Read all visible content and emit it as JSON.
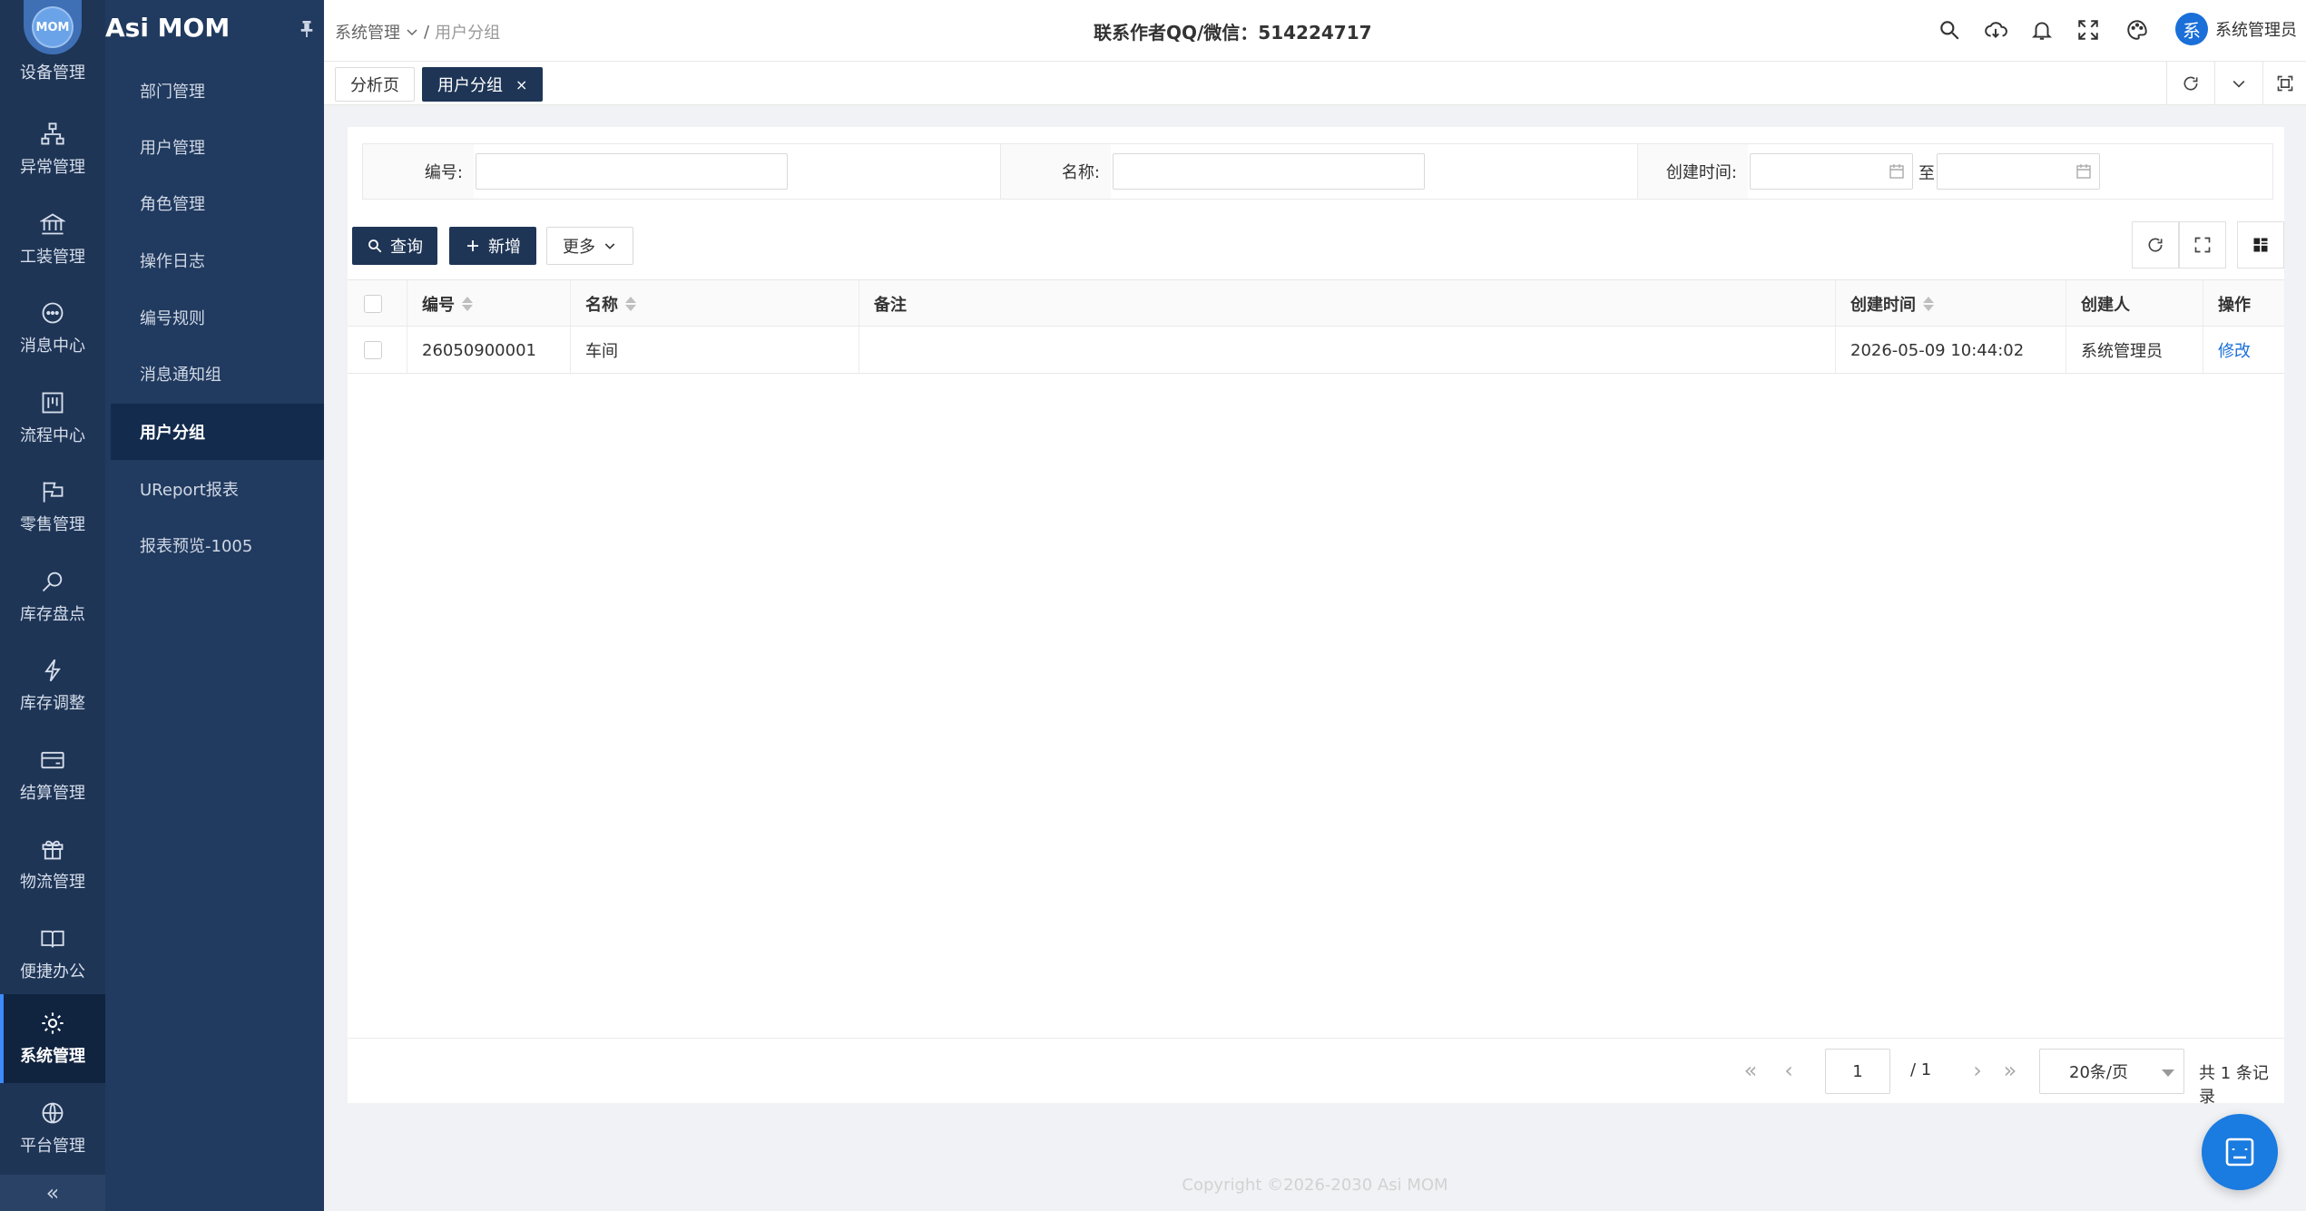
{
  "brand": {
    "logo_text": "MOM",
    "app_title": "Asi MOM"
  },
  "rail": {
    "first_label": "设备管理",
    "items": [
      {
        "label": "异常管理",
        "icon": "hierarchy-icon"
      },
      {
        "label": "工装管理",
        "icon": "bank-icon"
      },
      {
        "label": "消息中心",
        "icon": "chat-icon"
      },
      {
        "label": "流程中心",
        "icon": "board-icon"
      },
      {
        "label": "零售管理",
        "icon": "flag-icon"
      },
      {
        "label": "库存盘点",
        "icon": "magnify-icon"
      },
      {
        "label": "库存调整",
        "icon": "bolt-icon"
      },
      {
        "label": "结算管理",
        "icon": "wallet-icon"
      },
      {
        "label": "物流管理",
        "icon": "gift-icon"
      },
      {
        "label": "便捷办公",
        "icon": "book-icon"
      },
      {
        "label": "系统管理",
        "icon": "gear-icon",
        "active": true
      },
      {
        "label": "平台管理",
        "icon": "globe-icon"
      }
    ],
    "collapse": "«"
  },
  "submenu": {
    "items": [
      "部门管理",
      "用户管理",
      "角色管理",
      "操作日志",
      "编号规则",
      "消息通知组",
      "用户分组",
      "UReport报表",
      "报表预览-1005"
    ],
    "active_index": 6
  },
  "header": {
    "breadcrumb_parent": "系统管理",
    "breadcrumb_sep": "/",
    "breadcrumb_current": "用户分组",
    "contact": "联系作者QQ/微信：514224717",
    "user_avatar": "系",
    "user_name": "系统管理员"
  },
  "tabs": [
    {
      "label": "分析页",
      "active": false
    },
    {
      "label": "用户分组",
      "active": true,
      "close": "×"
    }
  ],
  "filters": {
    "code_label": "编号:",
    "code_value": "",
    "name_label": "名称:",
    "name_value": "",
    "time_label": "创建时间:",
    "time_sep": "至"
  },
  "toolbar": {
    "query": "查询",
    "add": "新增",
    "more": "更多"
  },
  "table": {
    "columns": [
      "编号",
      "名称",
      "备注",
      "创建时间",
      "创建人",
      "操作"
    ],
    "rows": [
      {
        "code": "26050900001",
        "name": "车间",
        "remark": "",
        "created": "2026-05-09 10:44:02",
        "creator": "系统管理员",
        "action": "修改"
      }
    ]
  },
  "pagination": {
    "page": "1",
    "total_pages": "/ 1",
    "page_size": "20条/页",
    "record_count": "共 1 条记录"
  },
  "footer": "Copyright ©2026-2030 Asi MOM",
  "colors": {
    "primary": "#1e3556",
    "rail": "#1e3556",
    "submenu": "#213a5f",
    "link": "#1a6fd8"
  }
}
